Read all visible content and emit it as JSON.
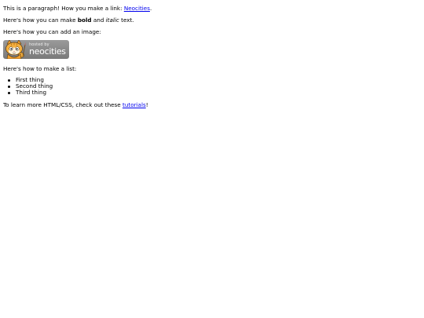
{
  "para1": {
    "text": "This is a paragraph! How you make a link: ",
    "link": "Neocities",
    "end": "."
  },
  "para2": {
    "before": "Here's how you can make ",
    "bold": "bold",
    "middle": " and ",
    "italic": "italic",
    "after": " text."
  },
  "para3": {
    "text": "Here's how you can add an image:"
  },
  "badge": {
    "small": "hosted by",
    "brand": "neocities",
    "background": "#8a8a8a"
  },
  "para4": {
    "text": "Here's how to make a list:"
  },
  "list": {
    "items": [
      "First thing",
      "Second thing",
      "Third thing"
    ]
  },
  "para5": {
    "before": "To learn more HTML/CSS, check out these ",
    "link": "tutorials",
    "after": "!"
  },
  "colors": {
    "link": "#0000ee",
    "text": "#000000",
    "background": "#ffffff"
  }
}
